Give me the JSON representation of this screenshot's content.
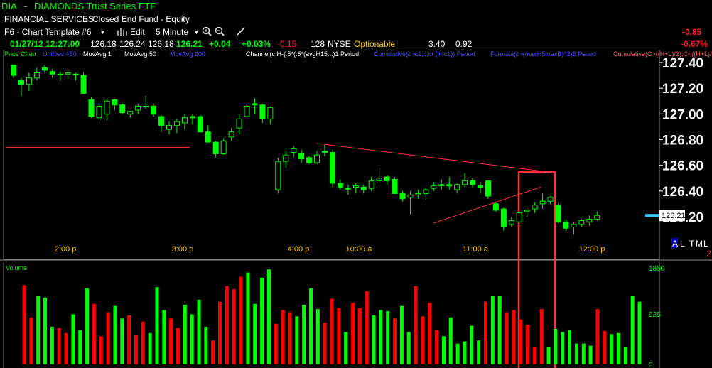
{
  "title_bar": {
    "symbol": "DIA",
    "separator": "-",
    "name": "DIAMONDS Trust Series ETF"
  },
  "info_bar": {
    "sector": "FINANCIAL SERVICES",
    "separator": "-",
    "category": "Closed End Fund - Equity"
  },
  "toolbar": {
    "template": "F6 - Chart Template #6",
    "edit_label": "Edit",
    "interval": "5 Minute",
    "right_change": "-0.85",
    "right_pct": "-0.67%"
  },
  "quote": {
    "datetime": "01/27/12 12:27:00",
    "open": "126.18",
    "high": "126.24",
    "low": "126.18",
    "close": "126.21",
    "change": "+0.04",
    "change_pct": "+0.03%",
    "net": "-0.15",
    "volume": "128",
    "exchange": "NYSE",
    "status": "Optionable",
    "val1": "3.40",
    "val2": "0.92"
  },
  "legend": [
    {
      "text": "Price Chart",
      "color": "#00ff00"
    },
    {
      "text": "Unifiled 450",
      "color": "#4a4aff"
    },
    {
      "text": "MovAvg 1",
      "color": "#ffffff"
    },
    {
      "text": "MovAvg 50",
      "color": "#ffffff"
    },
    {
      "text": "MovAvg 200",
      "color": "#4a4aff"
    },
    {
      "text": "Channel(c,H-(.5*(.5*(avgH15...)1 Period",
      "color": "#ffffff"
    },
    {
      "text": "Cumulative(c>c1,c,c<(li>c1)) Period",
      "color": "#4a4aff"
    },
    {
      "text": "Formula(c>(maxH5maxB)^2)2 Period",
      "color": "#4a4aff"
    },
    {
      "text": "Cumulative(C>((H+L)/2),C<((H+L)/2)",
      "color": "#ff6060"
    }
  ],
  "colors": {
    "up": "#00ff00",
    "down": "#ff0000",
    "ticker": "#00ff00",
    "annotation": "#ff3333",
    "last_price_marker": "#33ccff"
  },
  "time_labels": [
    "2:00 p",
    "3:00 p",
    "4:00 p",
    "10:00 a",
    "11:00 a",
    "12:00 p"
  ],
  "indicators": {
    "a": "A",
    "l": "L",
    "t": "T",
    "m": "M",
    "l2": "L",
    "page": "2"
  },
  "volume_panel": {
    "label": "Volume",
    "ticks": [
      "1850",
      "925",
      "0"
    ]
  },
  "chart_data": {
    "type": "candlestick",
    "y_ticks": [
      127.4,
      127.2,
      127.0,
      126.8,
      126.6,
      126.4,
      126.2
    ],
    "y_tick_labels": [
      "127.40",
      "127.20",
      "127.00",
      "126.80",
      "126.60",
      "126.40",
      "126.20"
    ],
    "ylim": [
      126.05,
      127.46
    ],
    "last_price": "126.21",
    "reference_line_y": 126.74,
    "candles": [
      [
        127.38,
        127.38,
        127.28,
        127.3
      ],
      [
        127.26,
        127.28,
        127.14,
        127.23
      ],
      [
        127.23,
        127.32,
        127.18,
        127.28
      ],
      [
        127.28,
        127.36,
        127.26,
        127.32
      ],
      [
        127.36,
        127.38,
        127.32,
        127.34
      ],
      [
        127.33,
        127.35,
        127.28,
        127.31
      ],
      [
        127.31,
        127.33,
        127.26,
        127.31
      ],
      [
        127.31,
        127.34,
        127.27,
        127.32
      ],
      [
        127.31,
        127.32,
        127.26,
        127.31
      ],
      [
        127.3,
        127.32,
        127.17,
        127.16
      ],
      [
        127.11,
        127.13,
        126.97,
        126.98
      ],
      [
        126.97,
        127.1,
        126.95,
        127.06
      ],
      [
        127.0,
        127.12,
        126.95,
        127.1
      ],
      [
        127.11,
        127.12,
        127.03,
        127.07
      ],
      [
        127.07,
        127.08,
        127.0,
        127.01
      ],
      [
        127.0,
        127.02,
        126.97,
        127.02
      ],
      [
        127.03,
        127.08,
        127.0,
        127.06
      ],
      [
        127.06,
        127.14,
        127.04,
        127.06
      ],
      [
        127.06,
        127.08,
        126.98,
        127.0
      ],
      [
        126.98,
        126.99,
        126.86,
        126.91
      ],
      [
        126.88,
        126.94,
        126.84,
        126.91
      ],
      [
        126.91,
        126.96,
        126.85,
        126.94
      ],
      [
        126.93,
        127.0,
        126.88,
        126.97
      ],
      [
        126.98,
        127.0,
        126.92,
        126.97
      ],
      [
        126.98,
        127.0,
        126.89,
        126.86
      ],
      [
        126.86,
        126.91,
        126.78,
        126.78
      ],
      [
        126.78,
        126.79,
        126.66,
        126.69
      ],
      [
        126.69,
        126.81,
        126.68,
        126.79
      ],
      [
        126.82,
        126.89,
        126.79,
        126.86
      ],
      [
        126.89,
        127.0,
        126.84,
        126.96
      ],
      [
        126.98,
        127.09,
        126.96,
        127.06
      ],
      [
        127.08,
        127.12,
        127.0,
        127.07
      ],
      [
        127.07,
        127.08,
        126.93,
        126.96
      ],
      [
        126.96,
        127.06,
        126.92,
        127.05
      ],
      [
        126.41,
        126.66,
        126.38,
        126.63
      ],
      [
        126.63,
        126.71,
        126.58,
        126.68
      ],
      [
        126.7,
        126.75,
        126.66,
        126.73
      ],
      [
        126.69,
        126.72,
        126.62,
        126.65
      ],
      [
        126.66,
        126.67,
        126.61,
        126.62
      ],
      [
        126.62,
        126.71,
        126.61,
        126.68
      ],
      [
        126.71,
        126.76,
        126.67,
        126.7
      ],
      [
        126.7,
        126.72,
        126.43,
        126.46
      ],
      [
        126.46,
        126.49,
        126.41,
        126.43
      ],
      [
        126.42,
        126.45,
        126.37,
        126.42
      ],
      [
        126.43,
        126.46,
        126.38,
        126.44
      ],
      [
        126.43,
        126.45,
        126.38,
        126.41
      ],
      [
        126.42,
        126.51,
        126.4,
        126.48
      ],
      [
        126.48,
        126.58,
        126.46,
        126.5
      ],
      [
        126.51,
        126.52,
        126.45,
        126.48
      ],
      [
        126.49,
        126.51,
        126.4,
        126.38
      ],
      [
        126.38,
        126.4,
        126.32,
        126.34
      ],
      [
        126.35,
        126.4,
        126.22,
        126.37
      ],
      [
        126.37,
        126.41,
        126.34,
        126.38
      ],
      [
        126.38,
        126.42,
        126.33,
        126.41
      ],
      [
        126.42,
        126.47,
        126.4,
        126.44
      ],
      [
        126.44,
        126.49,
        126.41,
        126.45
      ],
      [
        126.45,
        126.51,
        126.41,
        126.44
      ],
      [
        126.41,
        126.46,
        126.38,
        126.45
      ],
      [
        126.45,
        126.54,
        126.43,
        126.48
      ],
      [
        126.48,
        126.5,
        126.43,
        126.45
      ],
      [
        126.44,
        126.47,
        126.38,
        126.43
      ],
      [
        126.48,
        126.48,
        126.34,
        126.36
      ],
      [
        126.3,
        126.31,
        126.24,
        126.25
      ],
      [
        126.26,
        126.27,
        126.09,
        126.12
      ],
      [
        126.14,
        126.2,
        126.12,
        126.17
      ],
      [
        126.16,
        126.24,
        126.15,
        126.23
      ],
      [
        126.24,
        126.27,
        126.2,
        126.25
      ],
      [
        126.26,
        126.31,
        126.23,
        126.29
      ],
      [
        126.3,
        126.38,
        126.26,
        126.32
      ],
      [
        126.32,
        126.36,
        126.3,
        126.35
      ],
      [
        126.29,
        126.3,
        126.15,
        126.16
      ],
      [
        126.16,
        126.18,
        126.09,
        126.11
      ],
      [
        126.12,
        126.16,
        126.06,
        126.14
      ],
      [
        126.14,
        126.18,
        126.12,
        126.17
      ],
      [
        126.16,
        126.21,
        126.13,
        126.18
      ],
      [
        126.18,
        126.24,
        126.17,
        126.21
      ]
    ],
    "volume": [
      1520,
      900,
      1320,
      1280,
      720,
      700,
      600,
      960,
      660,
      1460,
      1160,
      540,
      1000,
      1120,
      880,
      940,
      560,
      820,
      600,
      1480,
      1040,
      880,
      700,
      1140,
      960,
      1240,
      720,
      460,
      1200,
      1500,
      1440,
      1680,
      1760,
      1160,
      1660,
      1820,
      780,
      1040,
      1000,
      920,
      1140,
      1460,
      1060,
      800,
      1260,
      1080,
      620,
      1180,
      1080,
      1400,
      940,
      1040,
      1020,
      880,
      1120,
      620,
      1500,
      920,
      1180,
      660,
      540,
      900,
      400,
      440,
      740,
      460,
      1200,
      1320,
      1320,
      1000,
      1040,
      860,
      760,
      340,
      1060,
      340,
      680,
      620,
      660,
      400,
      400,
      360,
      1060,
      640,
      580,
      600,
      340,
      1320,
      1200
    ],
    "volume_ylim": [
      0,
      1850
    ],
    "trendlines": [
      [
        126.77,
        126.55
      ],
      [
        126.15,
        126.43
      ]
    ],
    "annotation_box": {
      "top": 126.55,
      "bottom": "0"
    }
  }
}
